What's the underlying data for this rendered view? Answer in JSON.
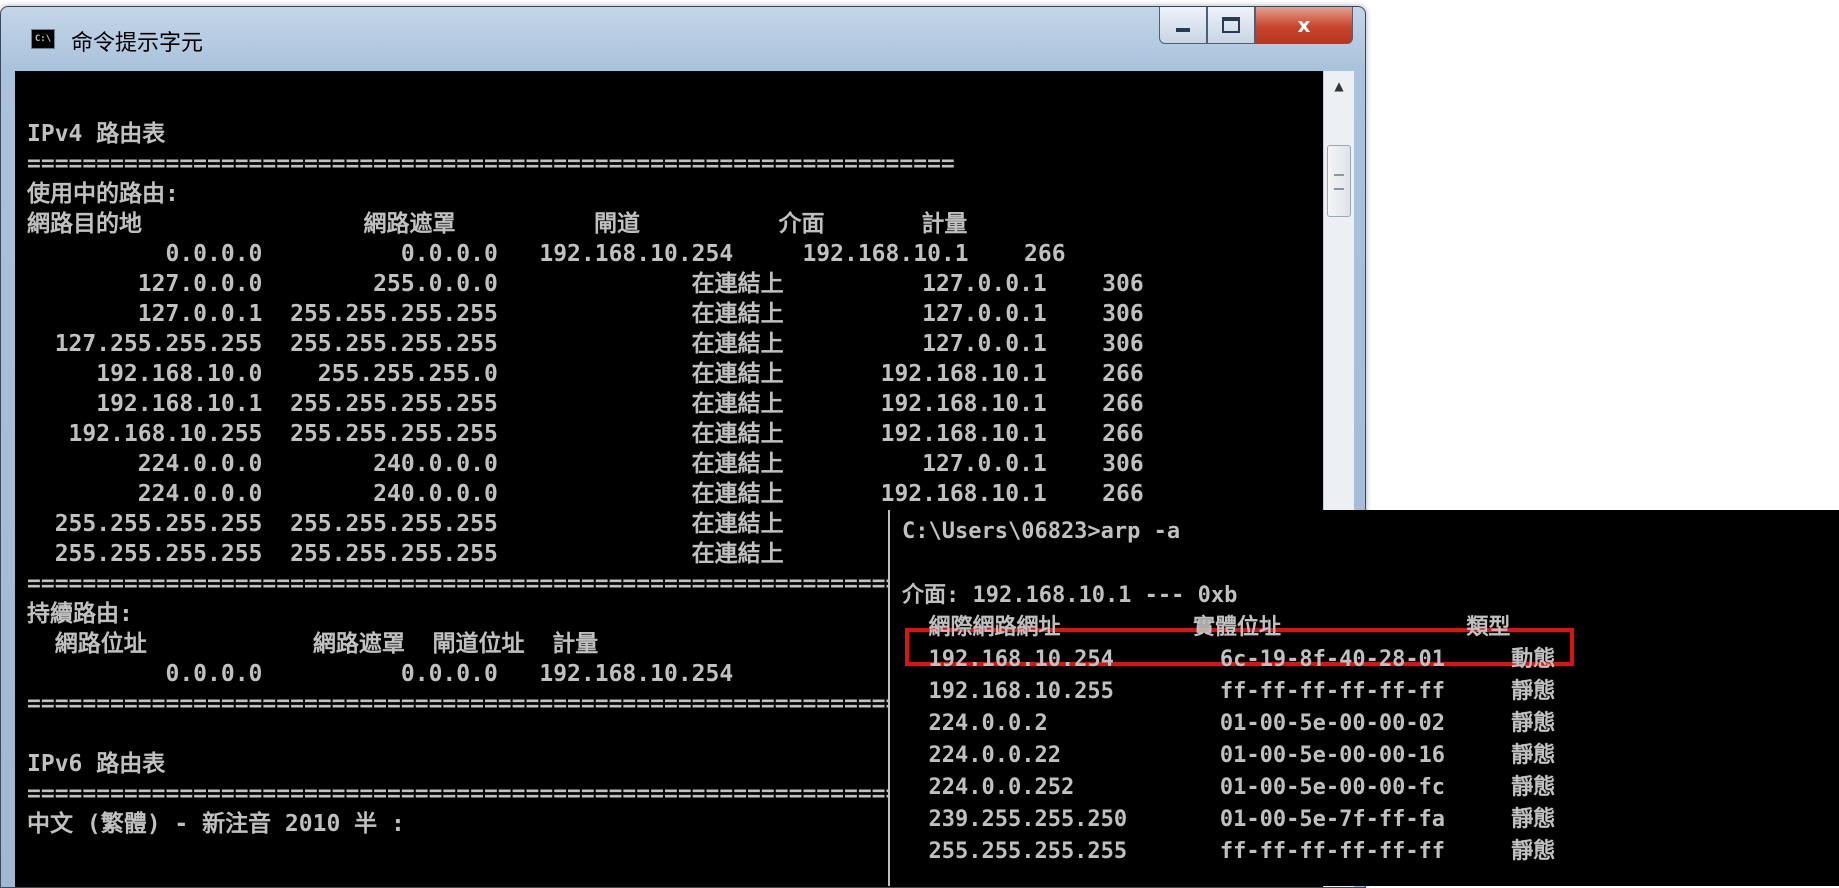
{
  "window": {
    "title": "命令提示字元",
    "icon": "cmd-icon",
    "controls": {
      "minimize": "minimize-icon",
      "maximize": "maximize-icon",
      "close": "x"
    }
  },
  "console": {
    "lines": [
      "",
      "IPv4 路由表",
      "===================================================================",
      "使用中的路由:",
      "網路目的地                網路遮罩          閘道          介面       計量",
      "          0.0.0.0          0.0.0.0   192.168.10.254     192.168.10.1    266",
      "        127.0.0.0        255.0.0.0              在連結上          127.0.0.1    306",
      "        127.0.0.1  255.255.255.255              在連結上          127.0.0.1    306",
      "  127.255.255.255  255.255.255.255              在連結上          127.0.0.1    306",
      "     192.168.10.0    255.255.255.0              在連結上       192.168.10.1    266",
      "     192.168.10.1  255.255.255.255              在連結上       192.168.10.1    266",
      "   192.168.10.255  255.255.255.255              在連結上       192.168.10.1    266",
      "        224.0.0.0        240.0.0.0              在連結上          127.0.0.1    306",
      "        224.0.0.0        240.0.0.0              在連結上       192.168.10.1    266",
      "  255.255.255.255  255.255.255.255              在連結上",
      "  255.255.255.255  255.255.255.255              在連結上",
      "===================================================================",
      "持續路由:",
      "  網路位址            網路遮罩  閘道位址  計量",
      "          0.0.0.0          0.0.0.0   192.168.10.254",
      "===================================================================",
      "",
      "IPv6 路由表",
      "===================================================================",
      "中文 (繁體) - 新注音 2010 半 :"
    ]
  },
  "arp_panel": {
    "lines": [
      "C:\\Users\\06823>arp -a",
      "",
      "介面: 192.168.10.1 --- 0xb",
      "  網際網路網址          實體位址              類型",
      "  192.168.10.254        6c-19-8f-40-28-01     動態",
      "  192.168.10.255        ff-ff-ff-ff-ff-ff     靜態",
      "  224.0.0.2             01-00-5e-00-00-02     靜態",
      "  224.0.0.22            01-00-5e-00-00-16     靜態",
      "  224.0.0.252           01-00-5e-00-00-fc     靜態",
      "  239.255.255.250       01-00-5e-7f-ff-fa     靜態",
      "  255.255.255.255       ff-ff-ff-ff-ff-ff     靜態"
    ],
    "highlight_color": "#e11111"
  },
  "colors": {
    "console_bg": "#000000",
    "console_text": "#c0c0c0"
  }
}
